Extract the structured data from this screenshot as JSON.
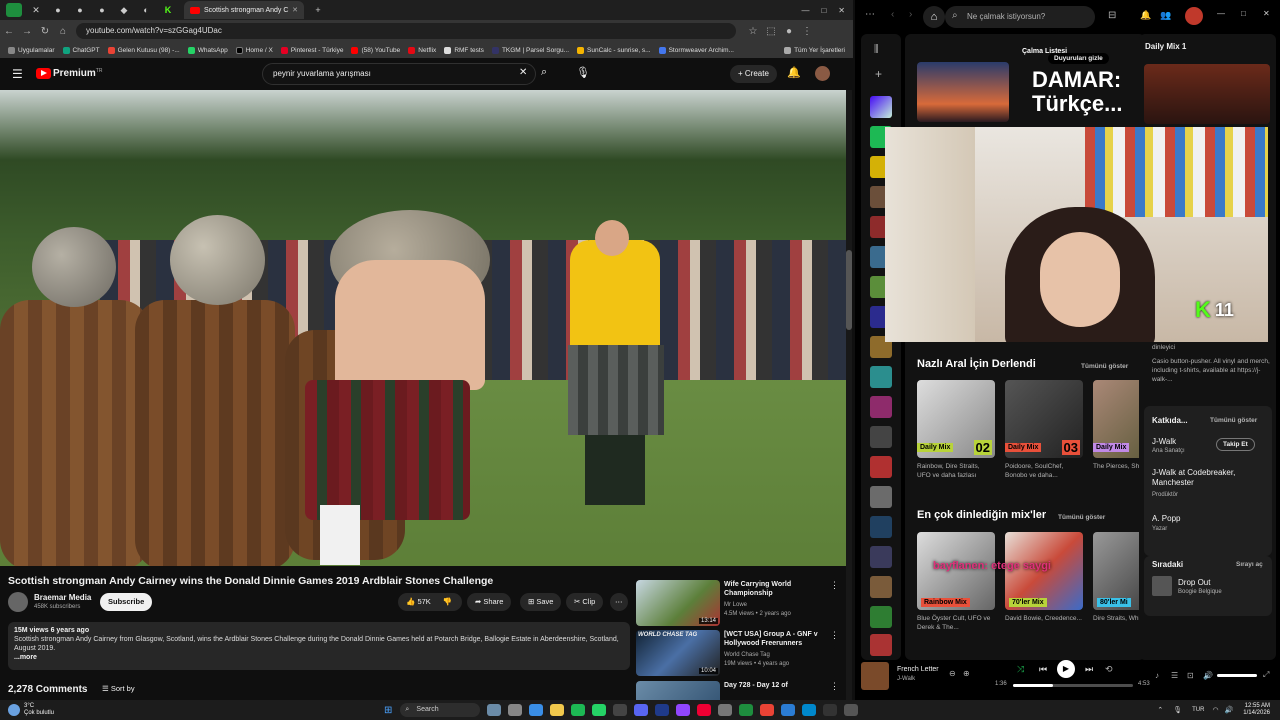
{
  "browser": {
    "active_tab_title": "Scottish strongman Andy C",
    "url": "youtube.com/watch?v=szGGag4UDac",
    "bookmarks": [
      "Uygulamalar",
      "ChatGPT",
      "Gelen Kutusu (98) -...",
      "WhatsApp",
      "Home / X",
      "Pinterest - Türkiye",
      "(58) YouTube",
      "Netflix",
      "RMF tests",
      "TKGM | Parsel Sorgu...",
      "SunCalc - sunrise, s...",
      "Stormweaver Archim..."
    ],
    "all_bookmarks": "Tüm Yer İşaretleri"
  },
  "youtube": {
    "logo": "Premium",
    "logo_sup": "TR",
    "search_value": "peynir yuvarlama yarışması",
    "create_label": "Create",
    "video_title": "Scottish strongman Andy Cairney wins the Donald Dinnie Games 2019 Ardblair Stones Challenge",
    "channel": "Braemar Media",
    "subscribers": "458K subscribers",
    "subscribe_label": "Subscribe",
    "likes": "57K",
    "share_label": "Share",
    "save_label": "Save",
    "clip_label": "Clip",
    "views_age": "15M views  6 years ago",
    "description": "Scottish strongman Andy Cairney from Glasgow, Scotland, wins the Ardblair Stones Challenge during the Donald Dinnie Games held at Potarch Bridge, Ballogie Estate in Aberdeenshire, Scotland, August 2019.",
    "more_label": "...more",
    "comments_count": "2,278 Comments",
    "sort_label": "Sort by",
    "recommended": [
      {
        "title": "Wife Carrying World Championship",
        "channel": "Mr Lowe",
        "meta": "4.5M views • 2 years ago",
        "duration": "13:14"
      },
      {
        "title": "[WCT USA] Group A - GNF v Hollywood Freerunners",
        "channel": "World Chase Tag",
        "meta": "19M views • 4 years ago",
        "duration": "10:04"
      },
      {
        "title": "Day 728 - Day 12 of",
        "channel": "",
        "meta": "",
        "duration": ""
      }
    ]
  },
  "spotify": {
    "search_placeholder": "Ne çalmak istiyorsun?",
    "playlist_label": "Çalma Listesi",
    "hero_title_1": "DAMAR:",
    "hero_title_2": "Türkçe...",
    "ad_hide": "Duyuruları gizle",
    "section1_title": "Nazlı Aral İçin Derlendi",
    "section2_title": "En çok dinlediğin mix'ler",
    "show_all": "Tümünü göster",
    "section1_cards": [
      {
        "badge": "Daily Mix",
        "num": "02",
        "sub": "Rainbow, Dire Straits, UFO ve daha fazlası",
        "color": "#b8d33a"
      },
      {
        "badge": "Daily Mix",
        "num": "03",
        "sub": "Poidoore, SoulChef, Bonobo ve daha...",
        "color": "#e8503a"
      },
      {
        "badge": "Daily Mix",
        "num": "",
        "sub": "The Pierces, Shivaree",
        "color": "#c189e6"
      }
    ],
    "section2_cards": [
      {
        "badge": "Rainbow Mix",
        "sub": "Blue Öyster Cult, UFO ve Derek & The...",
        "color": "#e8503a"
      },
      {
        "badge": "70'ler Mix",
        "sub": "David Bowie, Creedence...",
        "color": "#b8d33a"
      },
      {
        "badge": "80'ler Mi",
        "sub": "Dire Straits, Whitesnake",
        "color": "#3ac1e8"
      }
    ],
    "overlay_text": "bayflanen: etege saygi",
    "kick_count": "11",
    "right": {
      "title": "Daily Mix 1",
      "artist_bio_label": "dinleyici",
      "bio": "Casio button-pusher. All vinyl and merch, including t-shirts, available at https://j-walk-...",
      "credits_title": "Katkıda...",
      "credits_show_all": "Tümünü göster",
      "credits": [
        {
          "name": "J-Walk",
          "role": "Ana Sanatçı",
          "follow": "Takip Et"
        },
        {
          "name": "J-Walk at Codebreaker, Manchester",
          "role": "Prodüktör"
        },
        {
          "name": "A. Popp",
          "role": "Yazar"
        }
      ],
      "queue_title": "Sıradaki",
      "queue_open": "Sırayı aç",
      "queue_song": "Drop Out",
      "queue_artist": "Boogie Belgique"
    },
    "player": {
      "song": "French Letter",
      "artist": "J-Walk",
      "elapsed": "1:36",
      "total": "4:53",
      "progress": 0.33
    }
  },
  "taskbar": {
    "weather_temp": "3°C",
    "weather_desc": "Çok bulutlu",
    "search_label": "Search",
    "lang": "TUR",
    "time": "12:55 AM",
    "date": "1/14/2026"
  }
}
